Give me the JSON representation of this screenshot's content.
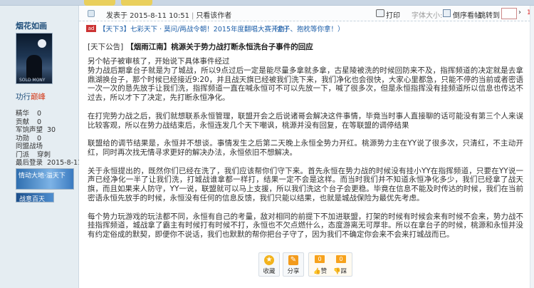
{
  "user": {
    "name": "烟花如画",
    "avatar_text": "SOLD MONY",
    "level": "功行",
    "level_name": "巅峰",
    "stats": [
      {
        "label": "精华",
        "value": "0"
      },
      {
        "label": "贡献",
        "value": "0"
      },
      {
        "label": "军饷声望",
        "value": "30"
      },
      {
        "label": "功勋",
        "value": "0"
      },
      {
        "label": "同盟战场",
        "value": ""
      },
      {
        "label": "门派",
        "value": "穿刺"
      },
      {
        "label": "最后登录",
        "value": "2015-8-11"
      }
    ],
    "medal_text": "情动大地·溢天下",
    "medal2_text": "战意百天"
  },
  "post_header": {
    "posted": "发表于 2015-8-11 10:51",
    "only_author": "只看该作者",
    "print": "打印",
    "font_size": "字体大小:",
    "order": "倒序看帖",
    "jump": "跳转到",
    "jump_go": "›",
    "floor": "1#"
  },
  "ad": {
    "tag": "ad",
    "text1": "【天下3】七彩天下 · 莫问/两战令朝！2015年度翻唱大赛开启！",
    "text2": "（金子、抱枕等你拿！）"
  },
  "post": {
    "category": "[天下公告]",
    "title": "【烟雨江南】桃源关于势力战打断永恒洗台子事件的回应",
    "paragraphs": [
      "另个帖子被审核了，开始说下具体事件经过",
      "势力战后期拿台子就是为了城战，所以9点过后一定是能尽量多拿就多拿，古星陵被洗的时候回防来不及，指挥频道的决定就是去拿鼎湖换台子，那个时候已经接近9:20，并且战天旗已经被我们洗下来，我们净化也会很快，大家心里都急，只能不停的当前或者密语一次一次的恳先放手让我们洗，指挥频道一直在喊永恒可不可以先放一下，喊了很多次，但是永恒指挥没有挂频道所以信息也传达不过去，所以才下了决定，先打断永恒净化。",
      "在打完势力战之后，我们就想联系永恒管理，联盟开会之后说诸哥会解决这件事情，毕竟当时事人直接聊的话可能没有第三个人来误比较客观，所以在势力战结束后，永恒连发几个天下嘲讽，桃源并没有回复，在等联盟的调停结果",
      "联盟给的调节结果是，永恒并不想谈。事情发生之后第二天晚上永恒全势力开红。桃源势力主在YY说了很多次，只清红，不主动开红，同时再次找无情寻求更好的解决办法，永恒依旧不想解决。",
      "关于永恒提出的，既然你们已经在洗了，我们应该帮你们守下来。首先永恒在势力战的时候没有挂小YY在指挥频道，只要在YY说一声已经净化一半了让我们洗，打城战谁拿都一样打，结果一定不会是这样。而当时我们并不知道永恒净化多少，我们已经拿了战天旗，而且如果来人防守，YY一说，联盟就可以马上支援，所以我们洗这个台子会更稳。毕竟在信息不能及时传达的时候，我们在当前密语永恒先放手的时候，永恒没有任何的信息反馈，我们只能以结果，也就是城战保险为最优先考虑。",
      "每个势力玩游戏的玩法都不同，永恒有自己的考量，敌对相同的前提下不加进联盟，打架的时候有时候会来有时候不会来，势力战不挂指挥频道，城战拿了霸主有时候打有时候不打，永恒也不欠点燃什么，态度游离无可厚非。所以在拿台子的时候，桃源和永恒并没有约定俗成的默契，即便你不说话，我们也默默的帮你把台子守了，因为我们不确定你会来不会来打城战而已。"
    ]
  },
  "actions": {
    "favorite": "收藏",
    "share": "分享",
    "like_count": "0",
    "like_label": "赞",
    "dislike_count": "0",
    "dislike_label": "踩"
  },
  "colors": {
    "link": "#1c5ea8",
    "accent": "#f7a21b",
    "sidebar_bg": "#e5edf2"
  }
}
